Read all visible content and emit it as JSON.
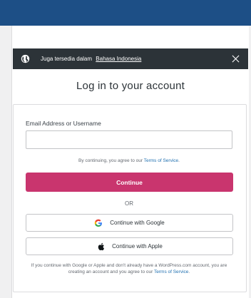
{
  "banner": {
    "text": "Juga tersedia dalam",
    "link": "Bahasa Indonesia",
    "globe_icon": "globe-icon",
    "close_icon": "close-icon"
  },
  "title": "Log in to your account",
  "form": {
    "email_label": "Email Address or Username",
    "email_value": "",
    "tos_prefix": "By continuing, you agree to our",
    "tos_link": "Terms of Service",
    "tos_suffix": ".",
    "continue_label": "Continue",
    "or_label": "OR"
  },
  "social": {
    "google_label": "Continue with Google",
    "apple_label": "Continue with Apple"
  },
  "footnote": {
    "text": "If you continue with Google or Apple and don't already have a WordPress.com account, you are creating an account and you agree to our",
    "link": "Terms of Service",
    "suffix": "."
  },
  "colors": {
    "header": "#1d4f86",
    "banner": "#2c3338",
    "primary_button": "#c9356e",
    "link": "#2271b1"
  }
}
